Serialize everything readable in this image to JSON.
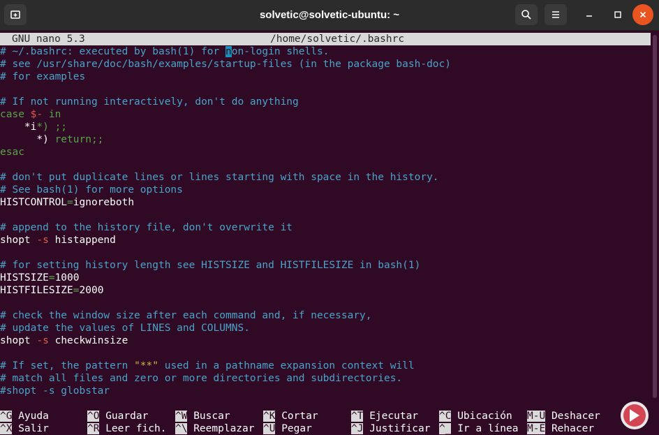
{
  "window": {
    "title": "solvetic@solvetic-ubuntu: ~",
    "new_tab_icon": "new-tab-icon",
    "search_icon": "search-icon",
    "menu_icon": "hamburger-menu-icon"
  },
  "nano": {
    "version": "GNU nano 5.3",
    "file_path": "/home/solvetic/.bashrc"
  },
  "file": {
    "l1a": "# ~/.bashrc: executed by bash(1) for ",
    "l1cursor": "n",
    "l1b": "on-login shells.",
    "l2": "# see /usr/share/doc/bash/examples/startup-files (in the package bash-doc)",
    "l3": "# for examples",
    "l5": "# If not running interactively, don't do anything",
    "l6a": "case ",
    "l6b": "$-",
    "l6c": " in",
    "l7a": "    *",
    "l7b": "i",
    "l7c": "*) ;;",
    "l8a": "      *) ",
    "l8b": "return;;",
    "l9": "esac",
    "l11": "# don't put duplicate lines or lines starting with space in the history.",
    "l12": "# See bash(1) for more options",
    "l13a": "HISTCONTROL",
    "l13b": "=",
    "l13c": "ignoreboth",
    "l15": "# append to the history file, don't overwrite it",
    "l16a": "shopt ",
    "l16b": "-s",
    "l16c": " histappend",
    "l18": "# for setting history length see HISTSIZE and HISTFILESIZE in bash(1)",
    "l19a": "HISTSIZE",
    "l19b": "=",
    "l19c": "1000",
    "l20a": "HISTFILESIZE",
    "l20b": "=",
    "l20c": "2000",
    "l22": "# check the window size after each command and, if necessary,",
    "l23": "# update the values of LINES and COLUMNS.",
    "l24a": "shopt ",
    "l24b": "-s",
    "l24c": " checkwinsize",
    "l26a": "# If set, the pattern ",
    "l26b": "\"**\"",
    "l26c": " used in a pathname expansion context will",
    "l27": "# match all files and zero or more directories and subdirectories.",
    "l28": "#shopt -s globstar"
  },
  "shortcuts": {
    "row1": [
      {
        "key": "^G",
        "label": "Ayuda"
      },
      {
        "key": "^O",
        "label": "Guardar"
      },
      {
        "key": "^W",
        "label": "Buscar"
      },
      {
        "key": "^K",
        "label": "Cortar"
      },
      {
        "key": "^T",
        "label": "Ejecutar"
      },
      {
        "key": "^C",
        "label": "Ubicación"
      },
      {
        "key": "M-U",
        "label": "Deshacer"
      }
    ],
    "row2": [
      {
        "key": "^X",
        "label": "Salir"
      },
      {
        "key": "^R",
        "label": "Leer fich."
      },
      {
        "key": "^\\",
        "label": "Reemplazar"
      },
      {
        "key": "^U",
        "label": "Pegar"
      },
      {
        "key": "^J",
        "label": "Justificar"
      },
      {
        "key": "^_",
        "label": "Ir a línea"
      },
      {
        "key": "M-E",
        "label": "Rehacer"
      }
    ]
  },
  "watermark": "solvetic-logo"
}
